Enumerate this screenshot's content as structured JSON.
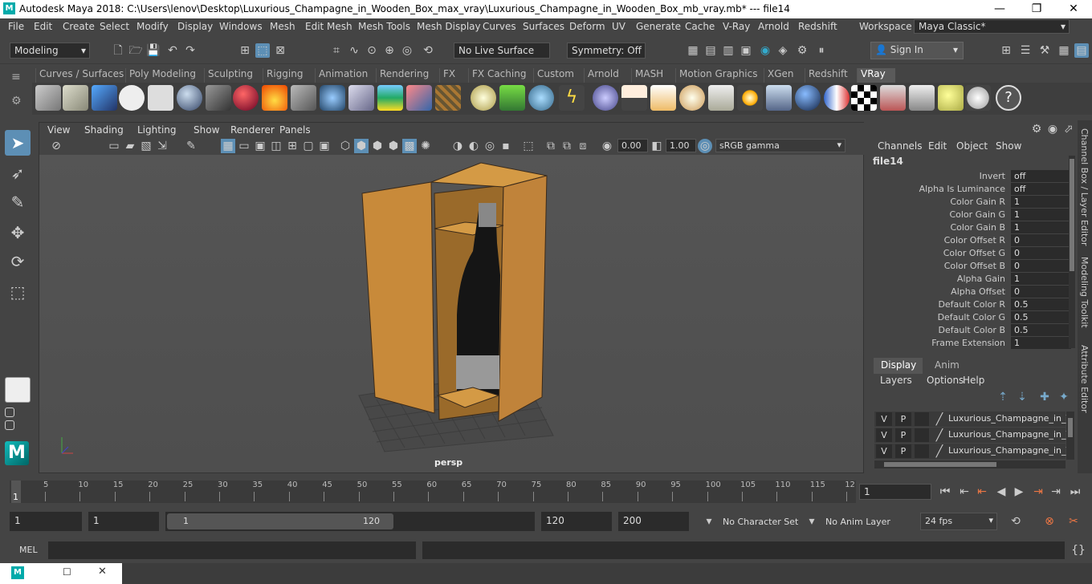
{
  "window": {
    "title": "Autodesk Maya 2018: C:\\Users\\lenov\\Desktop\\Luxurious_Champagne_in_Wooden_Box_max_vray\\Luxurious_Champagne_in_Wooden_Box_mb_vray.mb*   ---   file14",
    "logo": "M",
    "minimize": "—",
    "maximize": "❐",
    "close": "✕"
  },
  "menubar": {
    "items": [
      "File",
      "Edit",
      "Create",
      "Select",
      "Modify",
      "Display",
      "Windows",
      "Mesh",
      "Edit Mesh",
      "Mesh Tools",
      "Mesh Display",
      "Curves",
      "Surfaces",
      "Deform",
      "UV",
      "Generate",
      "Cache",
      "V-Ray",
      "Arnold",
      "Redshift"
    ],
    "workspace_label": "Workspace :",
    "workspace_value": "Maya Classic*"
  },
  "statusline": {
    "mode": "Modeling",
    "live_surface": "No Live Surface",
    "symmetry": "Symmetry: Off",
    "sign_in": "Sign In"
  },
  "shelf": {
    "tabs": [
      "Curves / Surfaces",
      "Poly Modeling",
      "Sculpting",
      "Rigging",
      "Animation",
      "Rendering",
      "FX",
      "FX Caching",
      "Custom",
      "Arnold",
      "MASH",
      "Motion Graphics",
      "XGen",
      "Redshift",
      "VRay"
    ],
    "active_tab": "VRay"
  },
  "viewport": {
    "menu": [
      "View",
      "Shading",
      "Lighting",
      "Show",
      "Renderer",
      "Panels"
    ],
    "exposure": "0.00",
    "gamma": "1.00",
    "color_space": "sRGB gamma",
    "camera": "persp"
  },
  "channel_box": {
    "menu": [
      "Channels",
      "Edit",
      "Object",
      "Show"
    ],
    "node": "file14",
    "attributes": [
      {
        "name": "Invert",
        "value": "off"
      },
      {
        "name": "Alpha Is Luminance",
        "value": "off"
      },
      {
        "name": "Color Gain R",
        "value": "1"
      },
      {
        "name": "Color Gain G",
        "value": "1"
      },
      {
        "name": "Color Gain B",
        "value": "1"
      },
      {
        "name": "Color Offset R",
        "value": "0"
      },
      {
        "name": "Color Offset G",
        "value": "0"
      },
      {
        "name": "Color Offset B",
        "value": "0"
      },
      {
        "name": "Alpha Gain",
        "value": "1"
      },
      {
        "name": "Alpha Offset",
        "value": "0"
      },
      {
        "name": "Default Color R",
        "value": "0.5"
      },
      {
        "name": "Default Color G",
        "value": "0.5"
      },
      {
        "name": "Default Color B",
        "value": "0.5"
      },
      {
        "name": "Frame Extension",
        "value": "1"
      }
    ]
  },
  "layer_editor": {
    "tabs": [
      "Display",
      "Anim"
    ],
    "menu": [
      "Layers",
      "Options",
      "Help"
    ],
    "rows": [
      {
        "v": "V",
        "p": "P",
        "name": "Luxurious_Champagne_in_V"
      },
      {
        "v": "V",
        "p": "P",
        "name": "Luxurious_Champagne_in_V"
      },
      {
        "v": "V",
        "p": "P",
        "name": "Luxurious_Champagne_in_V"
      }
    ]
  },
  "side_tabs": [
    "Channel Box / Layer Editor",
    "Modeling Toolkit",
    "Attribute Editor"
  ],
  "timeline": {
    "ticks": [
      "5",
      "10",
      "15",
      "20",
      "25",
      "30",
      "35",
      "40",
      "45",
      "50",
      "55",
      "60",
      "65",
      "70",
      "75",
      "80",
      "85",
      "90",
      "95",
      "100",
      "105",
      "110",
      "115",
      "12"
    ],
    "current_marker": "1",
    "current_frame": "1"
  },
  "range": {
    "start": "1",
    "playback_start": "1",
    "slider_start": "1",
    "slider_end": "120",
    "playback_end": "120",
    "end": "200",
    "character_set": "No Character Set",
    "anim_layer": "No Anim Layer",
    "fps": "24 fps"
  },
  "command": {
    "label": "MEL"
  }
}
